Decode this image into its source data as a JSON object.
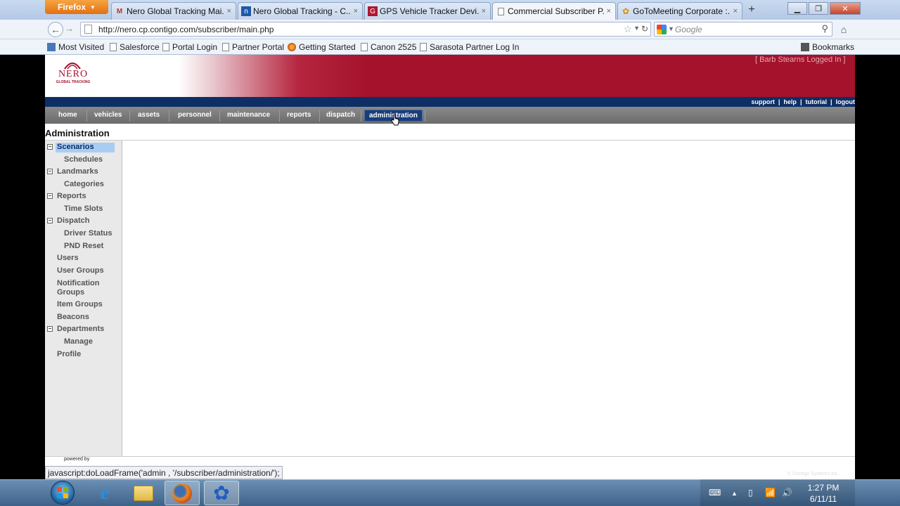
{
  "browser": {
    "menu_button": "Firefox",
    "tabs": [
      {
        "label": "Nero Global Tracking Mai...",
        "icon": "gmail-icon",
        "active": false
      },
      {
        "label": "Nero Global Tracking - C...",
        "icon": "nero-favicon",
        "active": false
      },
      {
        "label": "GPS Vehicle Tracker Devi...",
        "icon": "gps-favicon",
        "active": false
      },
      {
        "label": "Commercial Subscriber P...",
        "icon": "page-icon",
        "active": true
      },
      {
        "label": "GoToMeeting Corporate :...",
        "icon": "gotomeeting-icon",
        "active": false
      }
    ],
    "new_tab": "+",
    "url": "http://nero.cp.contigo.com/subscriber/main.php",
    "search_placeholder": "Google",
    "bookmarks": [
      {
        "label": "Most Visited",
        "icon": "most-visited-icon"
      },
      {
        "label": "Salesforce",
        "icon": "page-icon"
      },
      {
        "label": "Portal Login",
        "icon": "page-icon"
      },
      {
        "label": "Partner Portal",
        "icon": "page-icon"
      },
      {
        "label": "Getting Started",
        "icon": "firefox-icon"
      },
      {
        "label": "Canon 2525",
        "icon": "page-icon"
      },
      {
        "label": "Sarasota Partner Log In",
        "icon": "page-icon"
      }
    ],
    "bookmarks_menu": "Bookmarks",
    "status_text": "javascript:doLoadFrame('admin , '/subscriber/administration/');"
  },
  "site": {
    "logo_name": "NERO",
    "logo_sub": "GLOBAL TRACKING",
    "logged_in": "[ Barb Stearns Logged In ]",
    "utility_links": [
      "support",
      "help",
      "tutorial",
      "logout"
    ],
    "menu": [
      "home",
      "vehicles",
      "assets",
      "personnel",
      "maintenance",
      "reports",
      "dispatch",
      "administration"
    ],
    "active_menu": "administration",
    "page_title": "Administration",
    "sidebar": [
      {
        "label": "Scenarios",
        "level": 0,
        "toggle": "−",
        "selected": true
      },
      {
        "label": "Schedules",
        "level": 1
      },
      {
        "label": "Landmarks",
        "level": 0,
        "toggle": "−"
      },
      {
        "label": "Categories",
        "level": 1
      },
      {
        "label": "Reports",
        "level": 0,
        "toggle": "−"
      },
      {
        "label": "Time Slots",
        "level": 1
      },
      {
        "label": "Dispatch",
        "level": 0,
        "toggle": "−"
      },
      {
        "label": "Driver Status",
        "level": 1
      },
      {
        "label": "PND Reset",
        "level": 1
      },
      {
        "label": "Users",
        "level": 0
      },
      {
        "label": "User Groups",
        "level": 0
      },
      {
        "label": "Notification Groups",
        "level": 0
      },
      {
        "label": "Item Groups",
        "level": 0
      },
      {
        "label": "Beacons",
        "level": 0
      },
      {
        "label": "Departments",
        "level": 0,
        "toggle": "−"
      },
      {
        "label": "Manage",
        "level": 1
      },
      {
        "label": "Profile",
        "level": 0
      }
    ],
    "powered_by": "powered by",
    "copyright": "© Contigo Systems Inc."
  },
  "taskbar": {
    "apps": [
      "internet-explorer-icon",
      "file-explorer-icon",
      "firefox-icon",
      "gotomeeting-icon"
    ],
    "time": "1:27 PM",
    "date": "6/11/11"
  },
  "colors": {
    "brand_red": "#a4122c",
    "nav_blue": "#0d2f66",
    "selected_item": "#a9cdf2"
  }
}
